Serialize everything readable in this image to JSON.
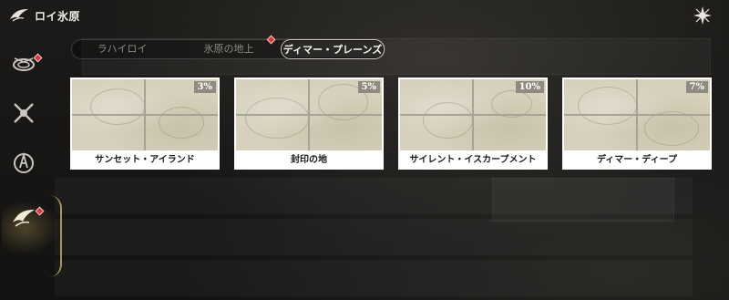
{
  "header": {
    "title": "ロイ氷原",
    "logo_icon": "winged-emblem-icon",
    "close_icon": "close-star-icon"
  },
  "sidebar": {
    "items": [
      {
        "icon": "coil-emblem-icon",
        "has_alert": true,
        "active": false
      },
      {
        "icon": "crossed-blades-icon",
        "has_alert": false,
        "active": false
      },
      {
        "icon": "rune-ring-icon",
        "has_alert": false,
        "active": false
      },
      {
        "icon": "winged-emblem-icon",
        "has_alert": true,
        "active": true
      }
    ]
  },
  "tabs": [
    {
      "label": "ラハイロイ",
      "active": false,
      "has_alert": false
    },
    {
      "label": "氷原の地上",
      "active": false,
      "has_alert": true
    },
    {
      "label": "ディマー・プレーンズ",
      "active": true,
      "has_alert": false
    }
  ],
  "cards": [
    {
      "name": "サンセット・アイランド",
      "progress": "3%"
    },
    {
      "name": "封印の地",
      "progress": "5%"
    },
    {
      "name": "サイレント・イスカープメント",
      "progress": "10%"
    },
    {
      "name": "ディマー・ディープ",
      "progress": "7%"
    }
  ],
  "colors": {
    "alert": "#d33b3b",
    "card_label_bg": "#ffffff",
    "progress_badge_bg": "#8f8b80",
    "map_tint": "#d6d0bc"
  }
}
